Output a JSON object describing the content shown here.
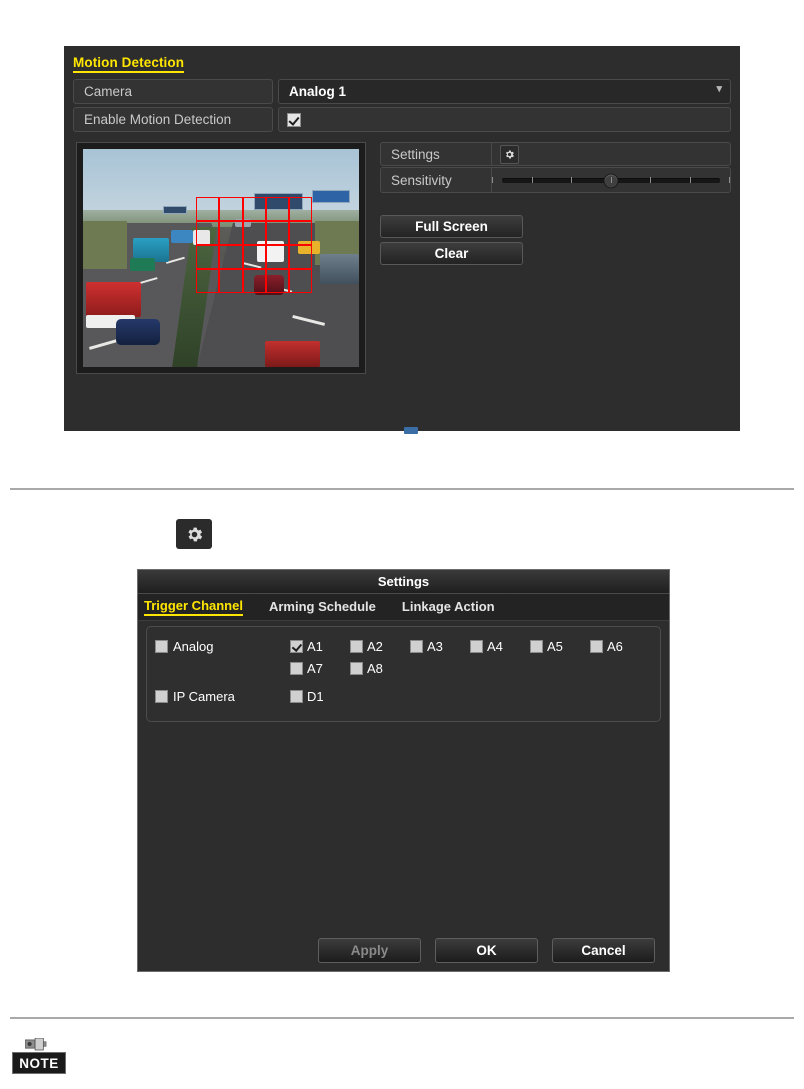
{
  "motion_detection": {
    "title": "Motion Detection",
    "camera_label": "Camera",
    "camera_value": "Analog 1",
    "camera_chevron": "chevron-down-icon",
    "enable_label": "Enable Motion Detection",
    "enable_checked": true,
    "settings_label": "Settings",
    "settings_icon": "gear-icon",
    "sensitivity_label": "Sensitivity",
    "sensitivity_percent": 50,
    "sensitivity_ticks": 7,
    "full_screen_label": "Full Screen",
    "clear_label": "Clear",
    "preview": {
      "name": "motion-detection-video-preview",
      "description": "Highway traffic scene with red motion detection grid overlay",
      "grid_columns": 5,
      "grid_rows": 4,
      "grid_color": "#ff0000"
    }
  },
  "standalone_gear": {
    "icon": "gear-icon"
  },
  "settings_dialog": {
    "title": "Settings",
    "tabs": [
      {
        "label": "Trigger Channel",
        "active": true
      },
      {
        "label": "Arming Schedule",
        "active": false
      },
      {
        "label": "Linkage Action",
        "active": false
      }
    ],
    "groups": [
      {
        "name": "Analog",
        "checked": false,
        "channels": [
          {
            "label": "A1",
            "checked": true
          },
          {
            "label": "A2",
            "checked": false
          },
          {
            "label": "A3",
            "checked": false
          },
          {
            "label": "A4",
            "checked": false
          },
          {
            "label": "A5",
            "checked": false
          },
          {
            "label": "A6",
            "checked": false
          },
          {
            "label": "A7",
            "checked": false
          },
          {
            "label": "A8",
            "checked": false
          }
        ]
      },
      {
        "name": "IP Camera",
        "checked": false,
        "channels": [
          {
            "label": "D1",
            "checked": false
          }
        ]
      }
    ],
    "buttons": {
      "apply": "Apply",
      "ok": "OK",
      "cancel": "Cancel"
    }
  },
  "note": {
    "label": "NOTE",
    "icon": "camera-icon"
  },
  "colors": {
    "accent_yellow": "#ffe600",
    "panel_bg": "#2d2d2d",
    "grid_red": "#ff0000",
    "page_bg": "#ffffff"
  }
}
